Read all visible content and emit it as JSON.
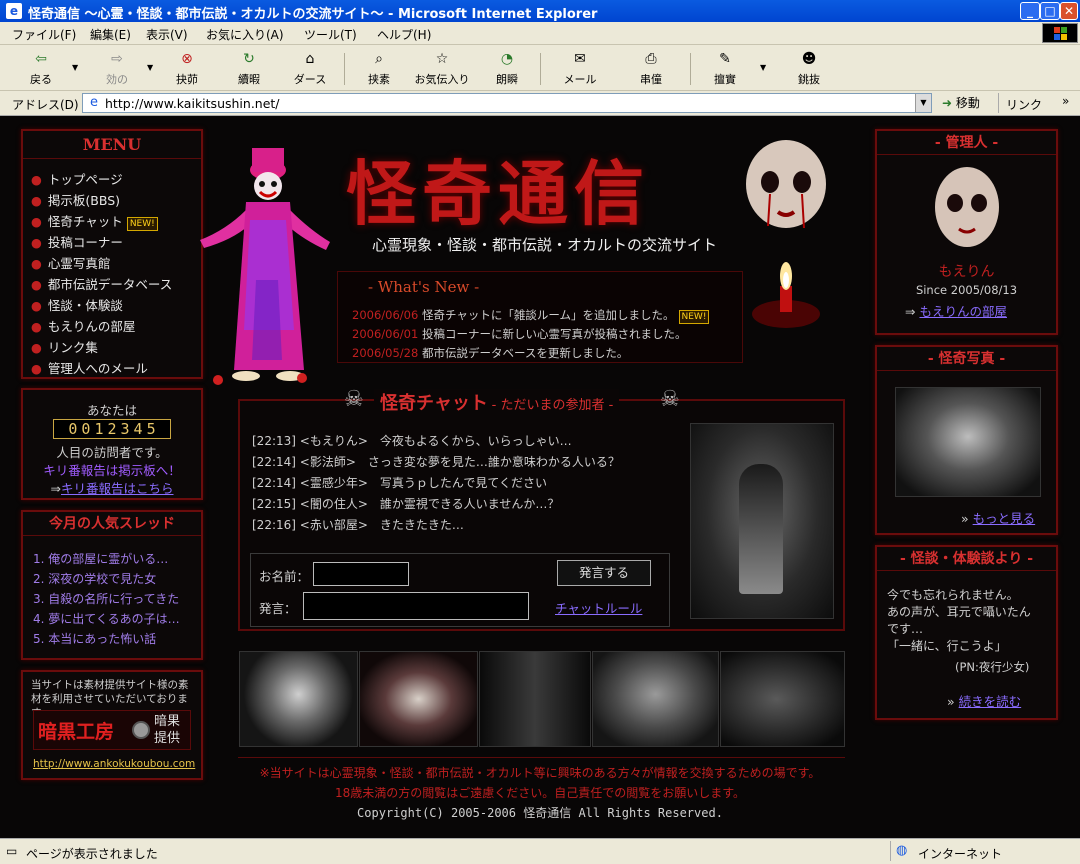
{
  "window": {
    "title": "怪奇通信 ～心霊・怪談・都市伝説・オカルトの交流サイト～ - Microsoft Internet Explorer"
  },
  "menubar": [
    "ファイル(F)",
    "編集(E)",
    "表示(V)",
    "お気に入り(A)",
    "ツール(T)",
    "ヘルプ(H)"
  ],
  "toolbar": {
    "back": "戻る",
    "forward": "効の",
    "stop": "抉茆",
    "refresh": "續暇",
    "home": "ダース",
    "search": "挟素",
    "favorites": "お気伝入り",
    "history": "朗瞬",
    "mail": "メール",
    "print": "串僮",
    "edit": "擅實",
    "messenger": "銚抜"
  },
  "address": {
    "label": "アドレス(D)",
    "url": "http://www.kaikitsushin.net/",
    "go": "移動",
    "links": "リンク"
  },
  "site": {
    "title": "怪奇通信",
    "subtitle": "心霊現象・怪談・都市伝説・オカルトの交流サイト",
    "menu": {
      "heading": "MENU",
      "items": [
        "トップページ",
        "掲示板(BBS)",
        "怪奇チャット",
        "投稿コーナー",
        "心霊写真館",
        "都市伝説データベース",
        "怪談・体験談",
        "もえりんの部屋",
        "リンク集",
        "管理人へのメール"
      ],
      "new_badge": "NEW!"
    },
    "counter": {
      "prefix": "あなたは",
      "digits": "0012345",
      "suffix": "人目の訪問者です。",
      "report1": "キリ番報告は掲示板へ！",
      "report2": "キリ番報告はこちら",
      "arrow": "⇒"
    },
    "threads": {
      "heading": "今月の人気スレッド",
      "items": [
        "1. 俺の部屋に霊がいる…",
        "2. 深夜の学校で見た女",
        "3. 自殺の名所に行ってきた",
        "4. 夢に出てくるあの子は…",
        "5. 本当にあった怖い話"
      ]
    },
    "banner": {
      "note": "当サイトは素材提供サイト様の素材を利用させていただいております。",
      "logo": "暗黒工房",
      "tag": "暗果提供",
      "url": "http://www.ankokukoubou.com"
    },
    "news": {
      "heading": "- What's New -",
      "items": [
        {
          "date": "2006/06/06",
          "text": "怪奇チャットに「雑談ルーム」を追加しました。",
          "new": "NEW!"
        },
        {
          "date": "2006/06/01",
          "text": "投稿コーナーに新しい心霊写真が投稿されました。"
        },
        {
          "date": "2006/05/28",
          "text": "都市伝説データベースを更新しました。"
        }
      ]
    },
    "chat": {
      "heading": "怪奇チャット",
      "sub": "- ただいまの参加者 -",
      "lines": [
        {
          "time": "[22:13]",
          "name": "<もえりん>",
          "msg": "今夜もよるくから、いらっしゃい…"
        },
        {
          "time": "[22:14]",
          "name": "<影法師>",
          "msg": "さっき変な夢を見た…誰か意味わかる人いる？"
        },
        {
          "time": "[22:14]",
          "name": "<霊感少年>",
          "msg": "写真うｐしたんで見てください"
        },
        {
          "time": "[22:15]",
          "name": "<闇の住人>",
          "msg": "誰か霊視できる人いませんか…？"
        },
        {
          "time": "[22:16]",
          "name": "<赤い部屋>",
          "msg": "きたきたきた…"
        }
      ],
      "name_label": "お名前：",
      "msg_label": "発言：",
      "submit": "発言する",
      "rules": "チャットルール"
    },
    "admin": {
      "heading": "- 管理人 -",
      "name": "もえりん",
      "since": "Since 2005/08/13",
      "link": "もえりんの部屋",
      "arrow": "⇒"
    },
    "photos": {
      "heading": "- 怪奇写真 -",
      "more": "もっと見る",
      "arrow": "»"
    },
    "story": {
      "heading": "- 怪談・体験談より -",
      "lines": [
        "今でも忘れられません。",
        "あの声が、耳元で囁いたん",
        "です…",
        "「一緒に、行こうよ」"
      ],
      "author": "(PN:夜行少女)",
      "more": "続きを読む",
      "arrow": "»"
    },
    "footer": {
      "line1": "※当サイトは心霊現象・怪談・都市伝説・オカルト等に興味のある方々が情報を交換するための場です。",
      "line2": "18歳未満の方の閲覧はご遠慮ください。自己責任での閲覧をお願いします。",
      "copyright": "Copyright(C) 2005-2006 怪奇通信 All Rights Reserved."
    }
  },
  "status": {
    "text": "ページが表示されました",
    "zone": "インターネット"
  }
}
